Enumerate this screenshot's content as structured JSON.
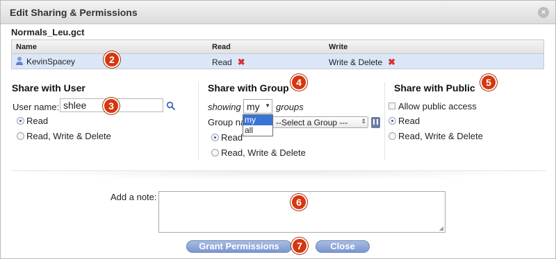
{
  "dialog": {
    "title": "Edit Sharing & Permissions",
    "close_label": "×"
  },
  "file": {
    "name": "Normals_Leu.gct"
  },
  "table": {
    "headers": [
      "Name",
      "Read",
      "Write"
    ],
    "rows": [
      {
        "name": "KevinSpacey",
        "read": "Read",
        "write": "Write & Delete",
        "remove": "✖"
      }
    ]
  },
  "share_user": {
    "title": "Share with User",
    "user_label": "User name:",
    "user_value": "shlee",
    "options": [
      "Read",
      "Read, Write & Delete"
    ]
  },
  "share_group": {
    "title": "Share with Group",
    "showing_label": "showing",
    "groups_label": "groups",
    "showing_value": "my",
    "showing_options": [
      "my",
      "all"
    ],
    "group_label": "Group na",
    "group_select": "--Select a Group ---",
    "options": [
      "Read",
      "Read, Write & Delete"
    ]
  },
  "share_public": {
    "title": "Share with Public",
    "allow_label": "Allow public access",
    "options": [
      "Read",
      "Read, Write & Delete"
    ]
  },
  "note": {
    "label": "Add a note:"
  },
  "buttons": {
    "grant": "Grant Permissions",
    "close": "Close"
  },
  "badges": [
    "2",
    "3",
    "4",
    "5",
    "6",
    "7"
  ],
  "colors": {
    "badge": "#d6370f",
    "row_highlight": "#dbe7f9",
    "button": "#7b97cf"
  }
}
